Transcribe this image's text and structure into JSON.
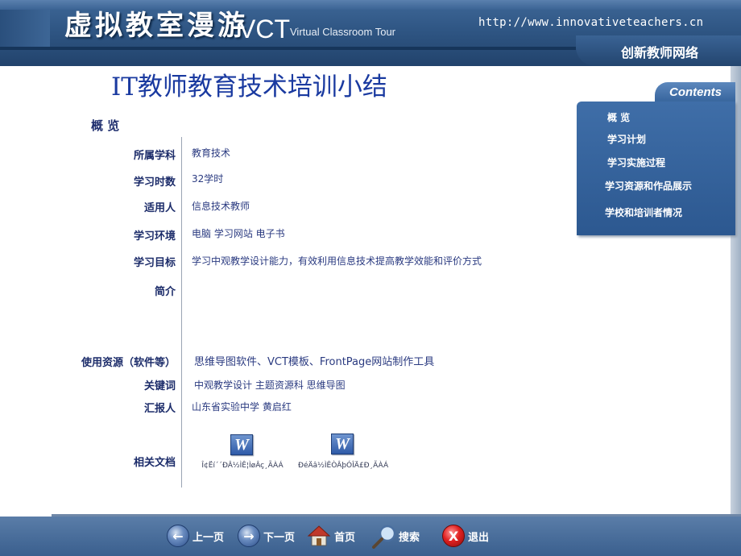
{
  "header": {
    "logo_cn": "虚拟教室漫游",
    "logo_vct": "VCT",
    "logo_sub": "Virtual Classroom Tour",
    "url": "http://www.innovativeteachers.cn",
    "network": "创新教师网络"
  },
  "contents": {
    "tab_label": "Contents",
    "items": [
      {
        "label": "概 览"
      },
      {
        "label": "学习计划"
      },
      {
        "label": "学习实施过程"
      },
      {
        "label": "学习资源和作品展示"
      },
      {
        "label": "学校和培训者情况"
      }
    ]
  },
  "main": {
    "title": "IT教师教育技术培训小结",
    "section": "概 览",
    "fields": [
      {
        "label": "所属学科",
        "value": "教育技术"
      },
      {
        "label": "学习时数",
        "value": "32学时"
      },
      {
        "label": "适用人",
        "value": "信息技术教师"
      },
      {
        "label": "学习环境",
        "value": "电脑 学习网站 电子书"
      },
      {
        "label": "学习目标",
        "value": "学习中观教学设计能力，有效利用信息技术提高教学效能和评价方式"
      },
      {
        "label": "简介",
        "value": ""
      },
      {
        "label": "使用资源（软件等）",
        "value": "思维导图软件、VCT模板、FrontPage网站制作工具"
      },
      {
        "label": "关键词",
        "value": "中观教学设计 主题资源科 思维导图"
      },
      {
        "label": "汇报人",
        "value": "山东省实验中学  黄启红"
      },
      {
        "label": "相关文档",
        "value": ""
      }
    ],
    "documents": [
      {
        "icon": "word-document-icon",
        "glyph": "W",
        "name": "Î¢Ëí´´ÐÂ½ÌÊ¦ÌøÂç¸ÃÀÁ"
      },
      {
        "icon": "word-document-icon",
        "glyph": "W",
        "name": "ÐéÄâ½ÌÊÒÂþÓÎÄ£Ð¸ÃÀÁ"
      }
    ]
  },
  "footer": {
    "prev": "上一页",
    "next": "下一页",
    "home": "首页",
    "search": "搜索",
    "exit": "退出",
    "prev_glyph": "←",
    "next_glyph": "→",
    "exit_glyph": "X"
  },
  "colors": {
    "header_bg": "#2f5684",
    "title": "#1a3aa0",
    "label": "#1c2c6a",
    "panel": "#3f6ea8",
    "exit_red": "#e02020"
  }
}
